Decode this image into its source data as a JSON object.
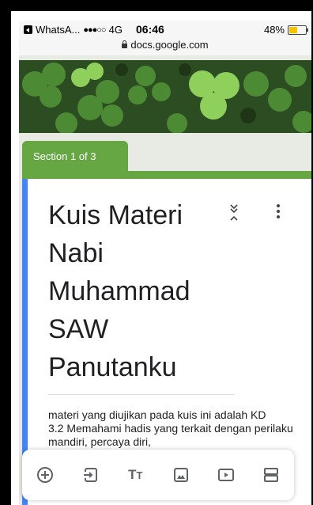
{
  "status": {
    "app": "WhatsA...",
    "signal": "●●●○○",
    "network": "4G",
    "time": "06:46",
    "battery": "48%"
  },
  "url": "docs.google.com",
  "form": {
    "section_label": "Section 1 of 3",
    "title": "Kuis Materi Nabi Muhammad SAW Panutanku",
    "description": "materi yang diujikan pada kuis ini adalah KD\n3.2 Memahami hadis yang terkait dengan perilaku mandiri, percaya diri,"
  },
  "colors": {
    "accent": "#66a744",
    "left_border": "#4285f4",
    "battery": "#f5c400"
  },
  "toolbar_icons": [
    "add-question-icon",
    "import-question-icon",
    "add-title-icon",
    "add-image-icon",
    "add-video-icon",
    "add-section-icon"
  ]
}
